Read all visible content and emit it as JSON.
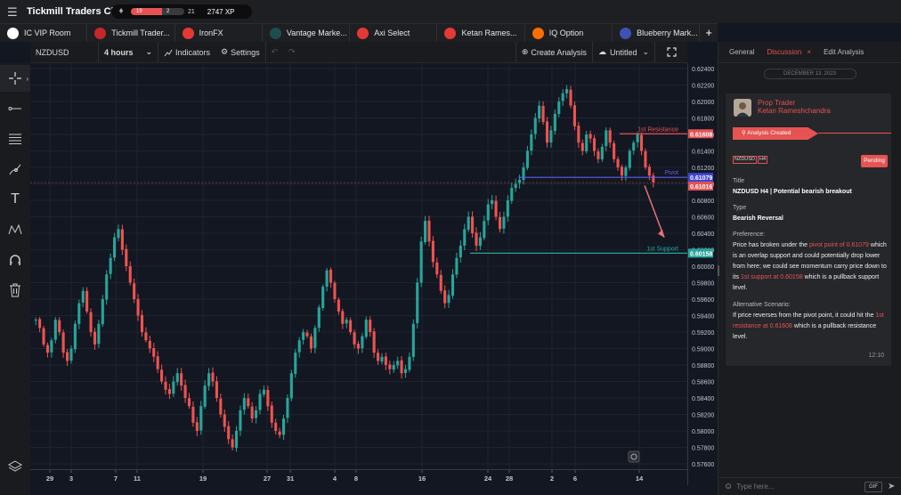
{
  "topbar": {
    "club_name": "Tickmill Traders Club",
    "xp_progress": 0.58,
    "xp_left": "19",
    "xp_right": "21",
    "xp_total": "2747 XP"
  },
  "tabs": [
    {
      "label": "IC VIP Room",
      "icon": "ic-logo",
      "color": "#ffffff"
    },
    {
      "label": "Tickmill Trader...",
      "icon": "tickmill-logo",
      "color": "#c62828"
    },
    {
      "label": "IronFX",
      "icon": "ironfx-logo",
      "color": "#e53935"
    },
    {
      "label": "Vantage Marke...",
      "icon": "vantage-logo",
      "color": "#1d4d4f"
    },
    {
      "label": "Axi Select",
      "icon": "axi-logo",
      "color": "#e53935"
    },
    {
      "label": "Ketan Rames...",
      "icon": "k-logo",
      "color": "#e53935"
    },
    {
      "label": "IQ Option",
      "icon": "iq-logo",
      "color": "#ff6d00"
    },
    {
      "label": "Blueberry Mark...",
      "icon": "blueberry-logo",
      "color": "#3f51b5"
    }
  ],
  "toolbar": {
    "symbol": "NZDUSD",
    "timeframe": "4 hours",
    "indicators": "Indicators",
    "settings": "Settings",
    "create_analysis": "Create Analysis",
    "untitled": "Untitled"
  },
  "chart_data": {
    "type": "candlestick",
    "symbol": "NZDUSD",
    "timeframe": "4 hours",
    "y_ticks": [
      "0.62400",
      "0.62200",
      "0.62000",
      "0.61800",
      "0.61600",
      "0.61400",
      "0.61200",
      "0.61000",
      "0.60800",
      "0.60600",
      "0.60400",
      "0.60200",
      "0.60000",
      "0.59800",
      "0.59600",
      "0.59400",
      "0.59200",
      "0.59000",
      "0.58800",
      "0.58600",
      "0.58400",
      "0.58200",
      "0.58000",
      "0.57800",
      "0.57600"
    ],
    "ylim": [
      0.576,
      0.624
    ],
    "x_ticks": [
      "29",
      "3",
      "7",
      "11",
      "19",
      "27",
      "31",
      "4",
      "8",
      "16",
      "24",
      "28",
      "2",
      "6",
      "14"
    ],
    "levels": [
      {
        "label": "1st Resistance",
        "value": 0.61608,
        "value_label": "0.61608",
        "color": "#e55353"
      },
      {
        "label": "Pivot",
        "value": 0.61079,
        "value_label": "0.61079",
        "color": "#5b5fe8"
      },
      {
        "label": "1st Support",
        "value": 0.60158,
        "value_label": "0.60158",
        "color": "#26a69a"
      }
    ],
    "current_price": {
      "value": 0.61016,
      "value_label": "0.61016",
      "color": "#e55353"
    },
    "price_path": [
      0.5935,
      0.5925,
      0.5905,
      0.5895,
      0.591,
      0.5935,
      0.592,
      0.5895,
      0.5885,
      0.59,
      0.593,
      0.5955,
      0.597,
      0.5945,
      0.592,
      0.5905,
      0.593,
      0.596,
      0.599,
      0.601,
      0.6035,
      0.6045,
      0.602,
      0.6,
      0.598,
      0.596,
      0.594,
      0.592,
      0.591,
      0.59,
      0.589,
      0.5875,
      0.586,
      0.585,
      0.5845,
      0.586,
      0.587,
      0.5855,
      0.584,
      0.583,
      0.581,
      0.58,
      0.583,
      0.5855,
      0.587,
      0.586,
      0.584,
      0.582,
      0.5805,
      0.579,
      0.578,
      0.58,
      0.5825,
      0.584,
      0.583,
      0.5815,
      0.5825,
      0.5845,
      0.585,
      0.583,
      0.581,
      0.58,
      0.5795,
      0.5815,
      0.584,
      0.587,
      0.5895,
      0.591,
      0.592,
      0.5915,
      0.59,
      0.5925,
      0.595,
      0.5975,
      0.5995,
      0.598,
      0.596,
      0.5945,
      0.593,
      0.5935,
      0.592,
      0.5905,
      0.59,
      0.5915,
      0.5935,
      0.592,
      0.5895,
      0.5885,
      0.589,
      0.588,
      0.5875,
      0.588,
      0.5885,
      0.587,
      0.5875,
      0.589,
      0.593,
      0.598,
      0.603,
      0.6055,
      0.603,
      0.6005,
      0.599,
      0.597,
      0.5955,
      0.5965,
      0.599,
      0.601,
      0.6025,
      0.6045,
      0.606,
      0.604,
      0.6025,
      0.6035,
      0.6055,
      0.6075,
      0.608,
      0.606,
      0.6045,
      0.606,
      0.608,
      0.6095,
      0.61,
      0.6105,
      0.612,
      0.614,
      0.616,
      0.618,
      0.6195,
      0.6175,
      0.615,
      0.6165,
      0.6185,
      0.62,
      0.621,
      0.6215,
      0.6195,
      0.617,
      0.615,
      0.614,
      0.616,
      0.6155,
      0.614,
      0.613,
      0.6145,
      0.6165,
      0.615,
      0.613,
      0.612,
      0.611,
      0.612,
      0.614,
      0.615,
      0.616,
      0.614,
      0.612,
      0.611,
      0.6102
    ]
  },
  "panel": {
    "tabs": [
      "General",
      "Discussion",
      "Edit Analysis"
    ],
    "close_symbol": "×",
    "date": "DECEMBER 13, 2023",
    "role": "Prop Trader",
    "author": "Ketan Rameshchandra",
    "analysis_created": "Analysis Created",
    "tags": [
      "NZDUSD",
      "H4"
    ],
    "status": "Pending",
    "title_label": "Title",
    "title_value": "NZDUSD H4 | Potential bearish breakout",
    "type_label": "Type",
    "type_value": "Bearish Reversal",
    "preference_label": "Preference:",
    "preference_parts": [
      {
        "text": "Price has broken under the ",
        "hl": false
      },
      {
        "text": "pivot point of 0.61079",
        "hl": true
      },
      {
        "text": " which is an overlap support and could potentially drop lower from here; we could see momentum carry price down to its ",
        "hl": false
      },
      {
        "text": "1st support at 0.60158",
        "hl": true
      },
      {
        "text": " which is a pullback support level.",
        "hl": false
      }
    ],
    "alt_label": "Alternative Scenario:",
    "alt_parts": [
      {
        "text": "If price reverses from the pivot point, it could hit the ",
        "hl": false
      },
      {
        "text": "1st resistance at 0.61608",
        "hl": true
      },
      {
        "text": " which is a pullback resistance level.",
        "hl": false
      }
    ],
    "time": "12:10",
    "input_placeholder": "Type here...",
    "gif_label": "GIF"
  }
}
